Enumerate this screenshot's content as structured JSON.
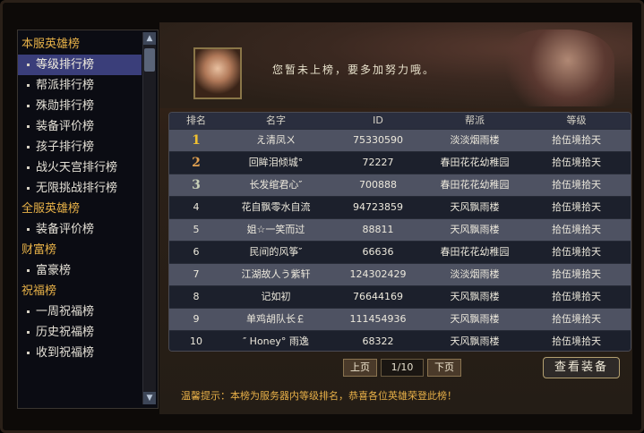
{
  "sidebar": {
    "items": [
      {
        "type": "cat",
        "label": "本服英雄榜"
      },
      {
        "type": "item",
        "label": "等级排行榜",
        "active": true
      },
      {
        "type": "item",
        "label": "帮派排行榜"
      },
      {
        "type": "item",
        "label": "殊勋排行榜"
      },
      {
        "type": "item",
        "label": "装备评价榜"
      },
      {
        "type": "item",
        "label": "孩子排行榜"
      },
      {
        "type": "item",
        "label": "战火天宫排行榜"
      },
      {
        "type": "item",
        "label": "无限挑战排行榜"
      },
      {
        "type": "cat",
        "label": "全服英雄榜"
      },
      {
        "type": "item",
        "label": "装备评价榜"
      },
      {
        "type": "cat",
        "label": "财富榜"
      },
      {
        "type": "item",
        "label": "富豪榜"
      },
      {
        "type": "cat",
        "label": "祝福榜"
      },
      {
        "type": "item",
        "label": "一周祝福榜"
      },
      {
        "type": "item",
        "label": "历史祝福榜"
      },
      {
        "type": "item",
        "label": "收到祝福榜"
      }
    ]
  },
  "banner": {
    "notice": "您暂未上榜，要多加努力哦。"
  },
  "table": {
    "headers": [
      "排名",
      "名字",
      "ID",
      "帮派",
      "等级"
    ],
    "rows": [
      {
        "rank": "1",
        "name": "え清凤ㄨ",
        "id": "75330590",
        "guild": "淡淡烟雨楼",
        "level": "拾伍境拾天"
      },
      {
        "rank": "2",
        "name": "回眸泪倾城°",
        "id": "72227",
        "guild": "春田花花幼稚园",
        "level": "拾伍境拾天"
      },
      {
        "rank": "3",
        "name": "长发绾君心″",
        "id": "700888",
        "guild": "春田花花幼稚园",
        "level": "拾伍境拾天"
      },
      {
        "rank": "4",
        "name": "花自飘零水自流",
        "id": "94723859",
        "guild": "天风飘雨楼",
        "level": "拾伍境拾天"
      },
      {
        "rank": "5",
        "name": "姐☆一笑而过",
        "id": "88811",
        "guild": "天风飘雨楼",
        "level": "拾伍境拾天"
      },
      {
        "rank": "6",
        "name": "民间的风筝″",
        "id": "66636",
        "guild": "春田花花幼稚园",
        "level": "拾伍境拾天"
      },
      {
        "rank": "7",
        "name": "江湖故人う紫轩",
        "id": "124302429",
        "guild": "淡淡烟雨楼",
        "level": "拾伍境拾天"
      },
      {
        "rank": "8",
        "name": "记如初",
        "id": "76644169",
        "guild": "天风飘雨楼",
        "level": "拾伍境拾天"
      },
      {
        "rank": "9",
        "name": "单鸡胡队长￡",
        "id": "111454936",
        "guild": "天风飘雨楼",
        "level": "拾伍境拾天"
      },
      {
        "rank": "10",
        "name": "″ Honey° 雨逸",
        "id": "68322",
        "guild": "天风飘雨楼",
        "level": "拾伍境拾天"
      }
    ]
  },
  "pager": {
    "prev": "上页",
    "page": "1/10",
    "next": "下页"
  },
  "view_button": "查看装备",
  "tip": "温馨提示：本榜为服务器内等级排名，恭喜各位英雄荣登此榜！",
  "colors": {
    "category": "#e8b248",
    "active_bg": "#3a3e7a",
    "tip": "#e8b048"
  }
}
